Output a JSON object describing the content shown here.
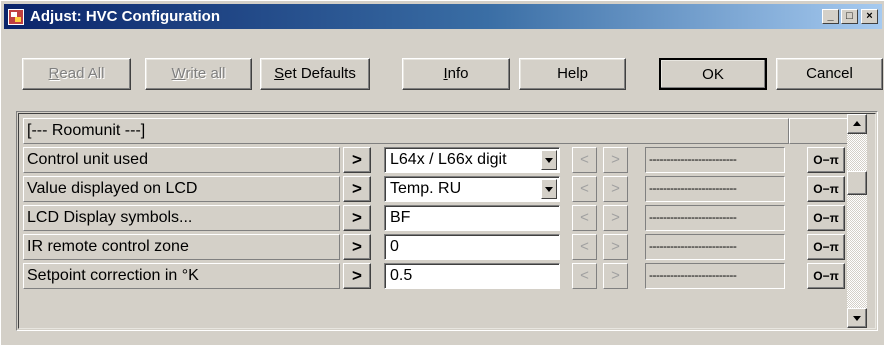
{
  "window": {
    "title": "Adjust: HVC Configuration",
    "caption_buttons": {
      "minimize": "_",
      "maximize": "□",
      "close": "×"
    }
  },
  "toolbar": {
    "read_all": {
      "prefix": "",
      "accel": "R",
      "rest": "ead All",
      "enabled": false
    },
    "write_all": {
      "prefix": "",
      "accel": "W",
      "rest": "rite all",
      "enabled": false
    },
    "set_defaults": {
      "prefix": "",
      "accel": "S",
      "rest": "et Defaults",
      "enabled": true
    },
    "info": {
      "prefix": "",
      "accel": "I",
      "rest": "nfo",
      "enabled": true
    },
    "help": "Help",
    "ok": "OK",
    "cancel": "Cancel"
  },
  "section": {
    "header": "[--- Roomunit ---]"
  },
  "rows": [
    {
      "label": "Control unit used",
      "arrow": ">",
      "value": "L64x / L66x digit",
      "type": "dropdown",
      "prev": "<",
      "next": ">",
      "raw": "-------------------------",
      "key_label": "O−π"
    },
    {
      "label": "Value displayed on LCD",
      "arrow": ">",
      "value": "Temp. RU",
      "type": "dropdown",
      "prev": "<",
      "next": ">",
      "raw": "-------------------------",
      "key_label": "O−π"
    },
    {
      "label": "LCD Display symbols...",
      "arrow": ">",
      "value": "BF",
      "type": "text",
      "prev": "<",
      "next": ">",
      "raw": "-------------------------",
      "key_label": "O−π"
    },
    {
      "label": "IR remote control zone",
      "arrow": ">",
      "value": "0",
      "type": "text",
      "prev": "<",
      "next": ">",
      "raw": "-------------------------",
      "key_label": "O−π"
    },
    {
      "label": "Setpoint correction in °K",
      "arrow": ">",
      "value": "0.5",
      "type": "text",
      "prev": "<",
      "next": ">",
      "raw": "-------------------------",
      "key_label": "O−π"
    }
  ],
  "colors": {
    "titlebar_start": "#0a246a",
    "titlebar_end": "#a6caf0",
    "face": "#d4d0c8"
  }
}
